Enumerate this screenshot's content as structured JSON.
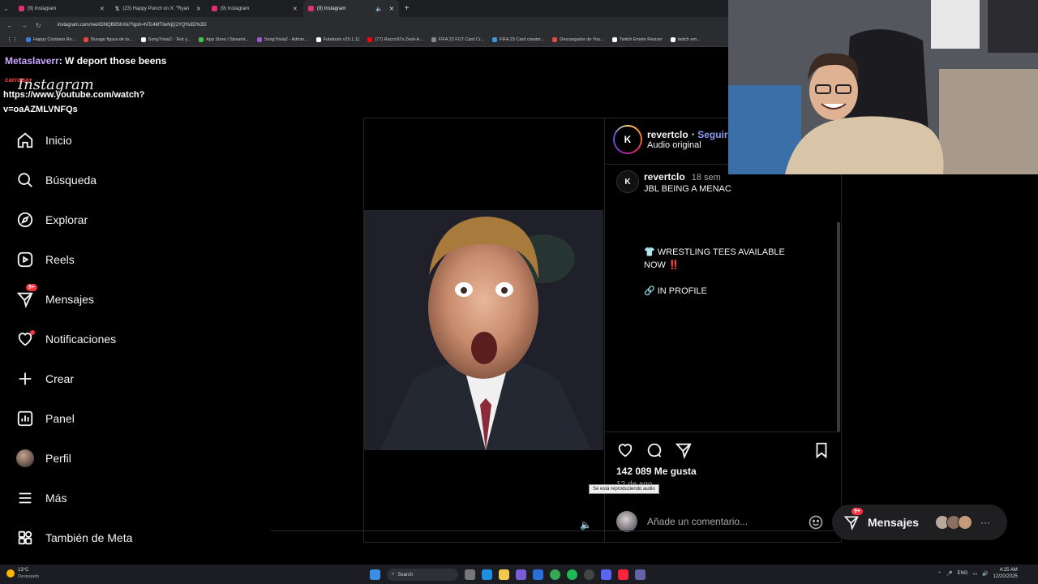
{
  "browser": {
    "tabs": [
      {
        "label": "(9) Instagram",
        "color": "#e1306c"
      },
      {
        "label": "(23) Happy Punch on X: \"Ryan",
        "color": "#ffffff"
      },
      {
        "label": "(9) Instagram",
        "color": "#e1306c"
      },
      {
        "label": "(9) Instagram",
        "color": "#e1306c",
        "active": true
      }
    ],
    "url": "instagram.com/reel/DNQB8ShXk/?igsh=NTc4MTIwNjQ2YQ%3D%3D",
    "bookmarks": [
      {
        "label": "Happy Cristiano Ro...",
        "color": "#3a7be0"
      },
      {
        "label": "Burago figura de to...",
        "color": "#e04a3a"
      },
      {
        "label": "SongTrivia2 - Test y...",
        "color": "#ffffff"
      },
      {
        "label": "App Store / Streami...",
        "color": "#46c34a"
      },
      {
        "label": "SongTrivia2 - Admin...",
        "color": "#9b59d0"
      },
      {
        "label": "Futetools v25.1.11",
        "color": "#ffffff"
      },
      {
        "label": "(77) Racco97s Zesti-A...",
        "color": "#ff0000"
      },
      {
        "label": "FIFA 23 FUT Card Cr...",
        "color": "#888888"
      },
      {
        "label": "FIFA 23 Card creator...",
        "color": "#3a9be0"
      },
      {
        "label": "Descargador de You...",
        "color": "#e04a3a"
      },
      {
        "label": "Twitch Emote Resizer",
        "color": "#ffffff"
      },
      {
        "label": "twitch em...",
        "color": "#ffffff"
      }
    ]
  },
  "chat": {
    "user": "Metaslaverr",
    "message": ": W deport those beens",
    "badge": "carroua+",
    "link": "https://www.youtube.com/watch?v=oaAZMLVNFQs"
  },
  "logo": "Instagram",
  "sidebar": {
    "items": [
      {
        "label": "Inicio",
        "icon": "home-icon"
      },
      {
        "label": "Búsqueda",
        "icon": "search-icon"
      },
      {
        "label": "Explorar",
        "icon": "compass-icon"
      },
      {
        "label": "Reels",
        "icon": "reels-icon"
      },
      {
        "label": "Mensajes",
        "icon": "messenger-icon",
        "badge": "9+"
      },
      {
        "label": "Notificaciones",
        "icon": "heart-icon"
      },
      {
        "label": "Crear",
        "icon": "plus-icon"
      },
      {
        "label": "Panel",
        "icon": "chart-icon"
      },
      {
        "label": "Perfil",
        "icon": "avatar"
      },
      {
        "label": "Más",
        "icon": "menu-icon"
      },
      {
        "label": "También de Meta",
        "icon": "meta-grid-icon"
      }
    ]
  },
  "post": {
    "username": "revertclo",
    "follow": "Seguir",
    "audio": "Audio original",
    "caption_user": "revertclo",
    "caption_time": "18 sem",
    "caption_line1": "JBL BEING A MENAC",
    "caption_line2": "👕 WRESTLING TEES AVAILABLE NOW ‼️",
    "caption_line3": "🔗 IN PROFILE",
    "likes": "142 089 Me gusta",
    "date": "12 de ago.",
    "comment_placeholder": "Añade un comentario...",
    "audio_tooltip": "Se está reproduciendo audio"
  },
  "messages_pill": {
    "label": "Mensajes",
    "badge": "9+"
  },
  "taskbar": {
    "weather_temp": "13°C",
    "weather_desc": "Despejado",
    "search": "Search",
    "lang": "ENG",
    "time": "4:25 AM",
    "date": "12/20/2025"
  }
}
